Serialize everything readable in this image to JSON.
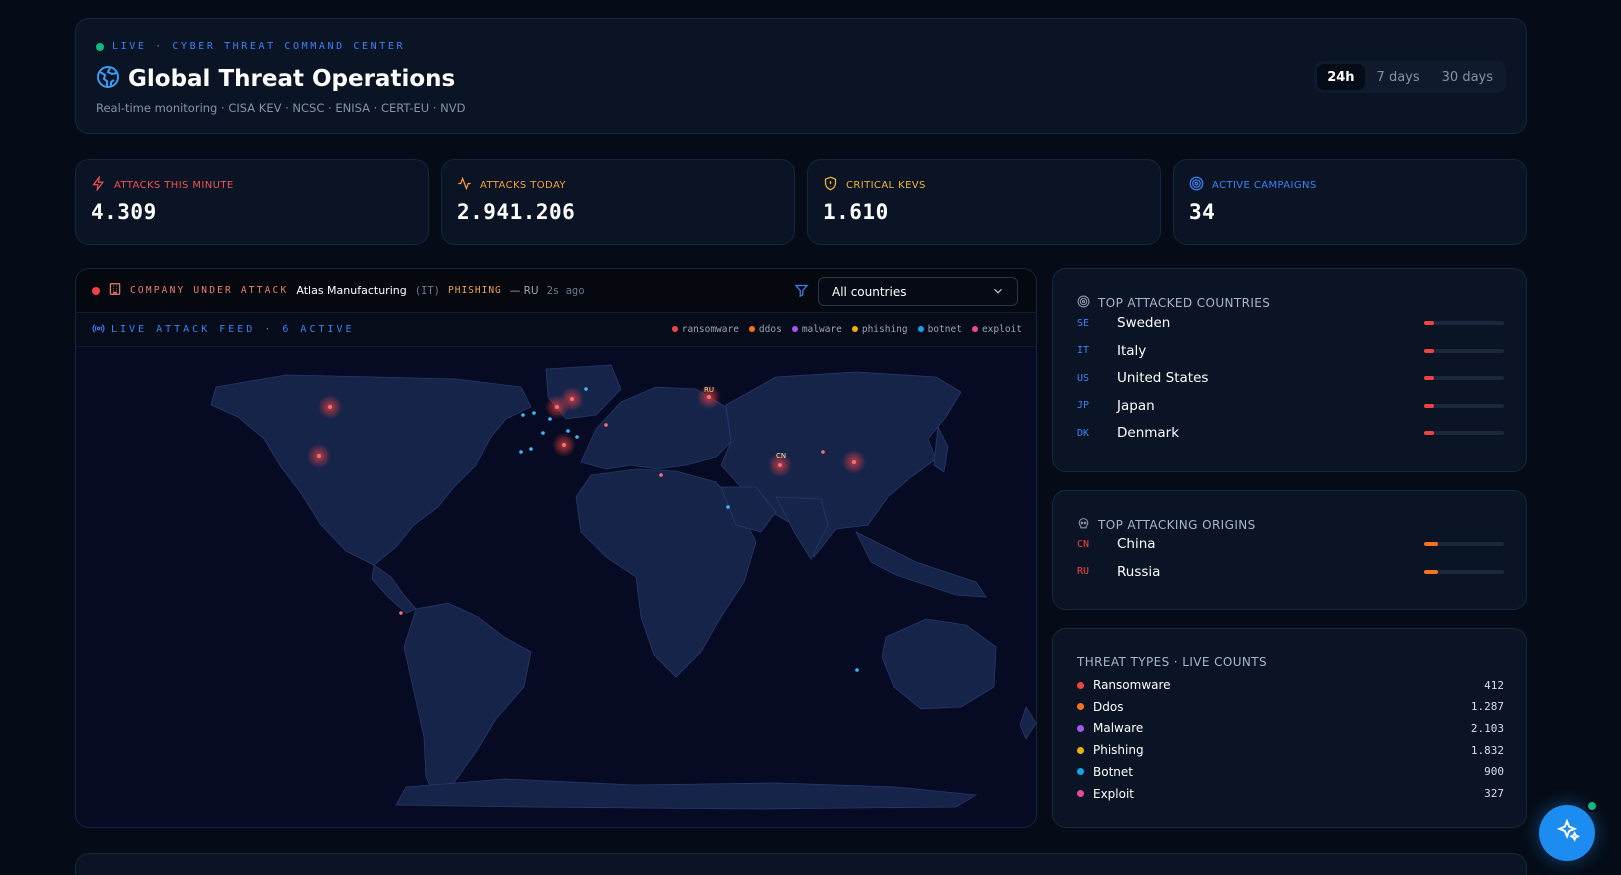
{
  "header": {
    "live_label": "LIVE · CYBER THREAT COMMAND CENTER",
    "title": "Global Threat Operations",
    "subtitle": "Real-time monitoring · CISA KEV · NCSC · ENISA · CERT-EU · NVD",
    "ranges": [
      "24h",
      "7 days",
      "30 days"
    ],
    "active_range": "24h"
  },
  "stats": [
    {
      "label": "ATTACKS THIS MINUTE",
      "value": "4.309",
      "color": "#f05252",
      "icon": "lightning-icon"
    },
    {
      "label": "ATTACKS TODAY",
      "value": "2.941.206",
      "color": "#f59e3b",
      "icon": "activity-icon"
    },
    {
      "label": "CRITICAL KEVS",
      "value": "1.610",
      "color": "#f5b33b",
      "icon": "shield-alert-icon"
    },
    {
      "label": "ACTIVE CAMPAIGNS",
      "value": "34",
      "color": "#3b82f6",
      "icon": "target-icon"
    }
  ],
  "attack_banner": {
    "label": "COMPANY UNDER ATTACK",
    "company": "Atlas Manufacturing",
    "country": "(IT)",
    "type": "PHISHING",
    "origin": "— RU",
    "time": "2s ago"
  },
  "filter": {
    "selected": "All countries"
  },
  "feed": {
    "title": "LIVE ATTACK FEED · 6 ACTIVE",
    "legend": [
      {
        "name": "ransomware",
        "color": "#ef4444"
      },
      {
        "name": "ddos",
        "color": "#f97316"
      },
      {
        "name": "malware",
        "color": "#a855f7"
      },
      {
        "name": "phishing",
        "color": "#eab308"
      },
      {
        "name": "botnet",
        "color": "#0ea5e9"
      },
      {
        "name": "exploit",
        "color": "#ec4899"
      }
    ],
    "map_labels": [
      "RU",
      "CN"
    ]
  },
  "top_attacked": {
    "title": "TOP ATTACKED COUNTRIES",
    "items": [
      {
        "code": "SE",
        "name": "Sweden",
        "share": 0.12
      },
      {
        "code": "IT",
        "name": "Italy",
        "share": 0.12
      },
      {
        "code": "US",
        "name": "United States",
        "share": 0.12
      },
      {
        "code": "JP",
        "name": "Japan",
        "share": 0.12
      },
      {
        "code": "DK",
        "name": "Denmark",
        "share": 0.12
      }
    ],
    "code_color": "#3b82f6",
    "bar_color": "#ef4444"
  },
  "top_origins": {
    "title": "TOP ATTACKING ORIGINS",
    "items": [
      {
        "code": "CN",
        "name": "China",
        "share": 0.18
      },
      {
        "code": "RU",
        "name": "Russia",
        "share": 0.18
      }
    ],
    "code_color": "#ef4444",
    "bar_color": "#f97316"
  },
  "threat_types": {
    "title": "THREAT TYPES · LIVE COUNTS",
    "items": [
      {
        "name": "Ransomware",
        "count": "412",
        "color": "#ef4444"
      },
      {
        "name": "Ddos",
        "count": "1.287",
        "color": "#f97316"
      },
      {
        "name": "Malware",
        "count": "2.103",
        "color": "#a855f7"
      },
      {
        "name": "Phishing",
        "count": "1.832",
        "color": "#eab308"
      },
      {
        "name": "Botnet",
        "count": "900",
        "color": "#0ea5e9"
      },
      {
        "name": "Exploit",
        "count": "327",
        "color": "#ec4899"
      }
    ]
  }
}
